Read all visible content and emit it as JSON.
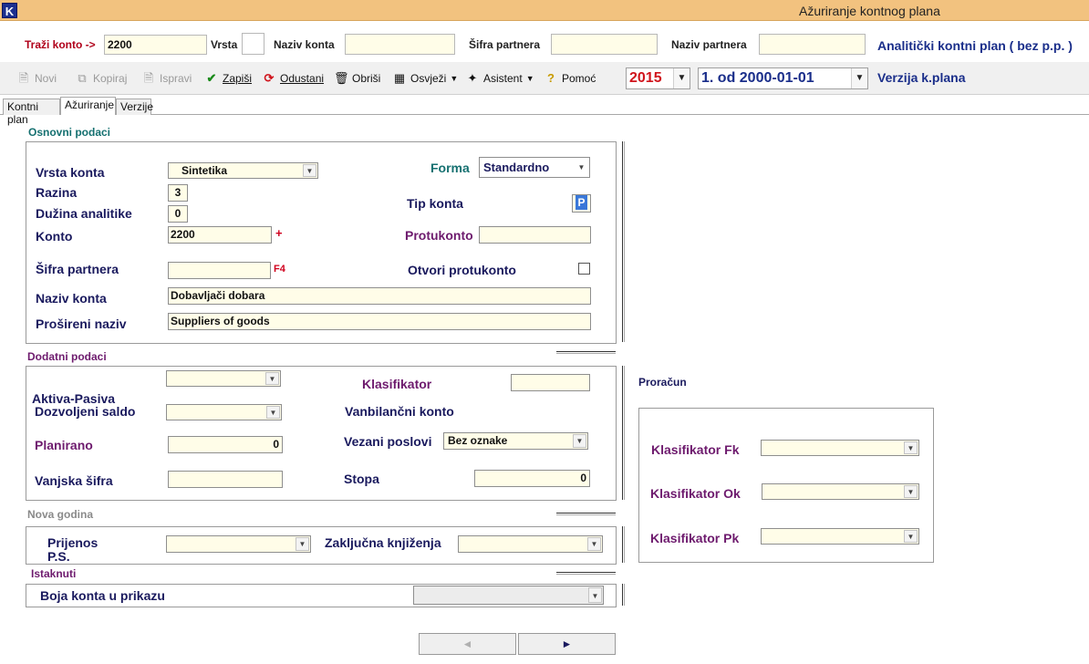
{
  "window": {
    "title": "Ažuriranje kontnog plana",
    "logo": "K"
  },
  "search": {
    "trazi_konto_label": "Traži konto ->",
    "trazi_konto_value": "2200",
    "vrsta_label": "Vrsta",
    "naziv_konta_label": "Naziv konta",
    "sifra_partnera_label": "Šifra partnera",
    "naziv_partnera_label": "Naziv partnera",
    "plan_title": "Analitički kontni plan ( bez p.p. )"
  },
  "toolbar": {
    "novi": "Novi",
    "kopiraj": "Kopiraj",
    "ispravi": "Ispravi",
    "zapisi": "Zapiši",
    "odustani": "Odustani",
    "obrisi": "Obriši",
    "osvjezi": "Osvježi",
    "asistent": "Asistent",
    "pomoc": "Pomoć",
    "year": "2015",
    "version": "1. od 2000-01-01",
    "verzija_label": "Verzija k.plana"
  },
  "tabs": [
    {
      "label": "Kontni plan"
    },
    {
      "label": "Ažuriranje"
    },
    {
      "label": "Verzije"
    }
  ],
  "osnovni": {
    "title": "Osnovni podaci",
    "vrsta_konta_label": "Vrsta konta",
    "vrsta_konta_value": "Sintetika",
    "razina_label": "Razina",
    "razina_value": "3",
    "duzina_label": "Dužina analitike",
    "duzina_value": "0",
    "konto_label": "Konto",
    "konto_value": "2200",
    "konto_plus": "+",
    "sifra_label": "Šifra partnera",
    "f4": "F4",
    "naziv_label": "Naziv konta",
    "naziv_value": "Dobavljači dobara",
    "prosireni_label": "Prošireni naziv",
    "prosireni_value": "Suppliers of goods",
    "forma_label": "Forma",
    "forma_value": "Standardno",
    "tip_label": "Tip konta",
    "tip_value": "P",
    "protukonto_label": "Protukonto",
    "otvori_label": "Otvori protukonto"
  },
  "dodatni": {
    "title": "Dodatni podaci",
    "aktiva_label": "Aktiva-Pasiva",
    "dozvoljeni_label": "Dozvoljeni saldo",
    "planirano_label": "Planirano",
    "planirano_value": "0",
    "vanjska_label": "Vanjska šifra",
    "klasifikator_label": "Klasifikator",
    "vanbilancni_label": "Vanbilančni konto",
    "vezani_label": "Vezani poslovi",
    "vezani_value": "Bez oznake",
    "stopa_label": "Stopa",
    "stopa_value": "0"
  },
  "proracun": {
    "title": "Proračun",
    "fk_label": "Klasifikator Fk",
    "ok_label": "Klasifikator Ok",
    "pk_label": "Klasifikator Pk"
  },
  "nova_godina": {
    "title": "Nova godina",
    "prijenos_label_1": "Prijenos",
    "prijenos_label_2": "P.S.",
    "zakljucna_label": "Zaključna knjiženja"
  },
  "istaknuti": {
    "title": "Istaknuti",
    "boja_label": "Boja konta u prikazu"
  },
  "nav": {
    "prev": "◄",
    "next": "►"
  }
}
